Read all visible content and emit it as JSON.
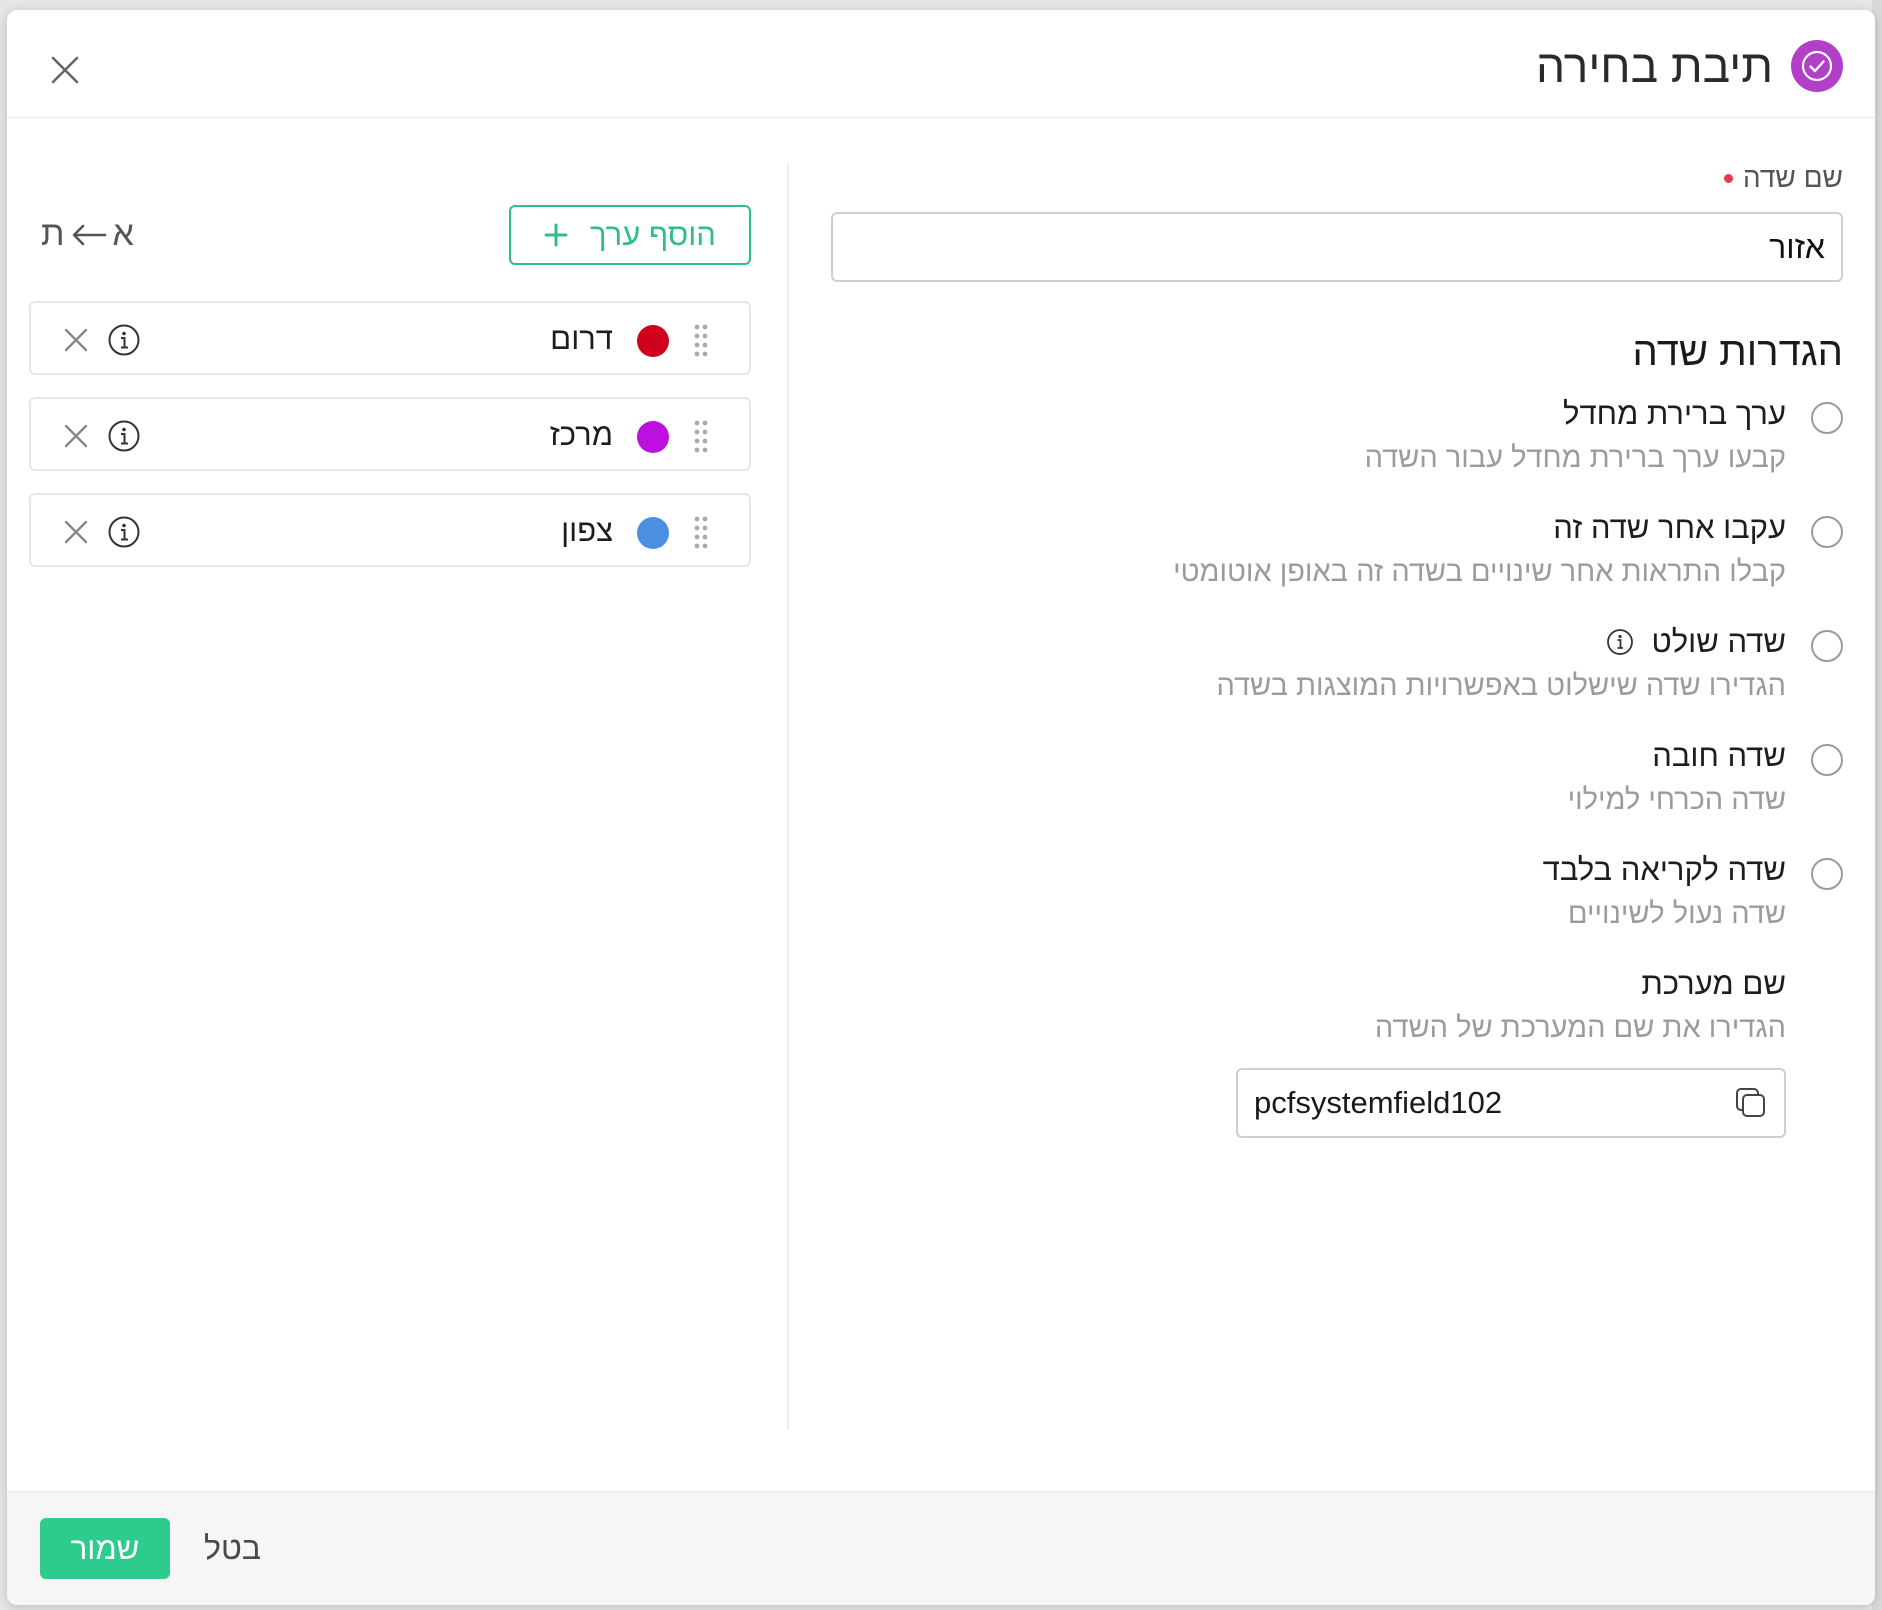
{
  "dialog": {
    "title": "תיבת בחירה",
    "accent_color": "#b23fc8"
  },
  "field_name": {
    "label": "שם שדה",
    "value": "אזור",
    "required_color": "#e8394d"
  },
  "settings": {
    "title": "הגדרות שדה",
    "options": [
      {
        "title": "ערך ברירת מחדל",
        "description": "קבעו ערך ברירת מחדל עבור השדה"
      },
      {
        "title": "עקבו אחר שדה זה",
        "description": "קבלו התראות אחר שינויים בשדה זה באופן אוטומטי"
      },
      {
        "title": "שדה שולט",
        "description": "הגדירו שדה שישלוט באפשרויות המוצגות בשדה",
        "info_icon": "info-icon"
      },
      {
        "title": "שדה חובה",
        "description": "שדה הכרחי למילוי"
      },
      {
        "title": "שדה לקריאה בלבד",
        "description": "שדה נעול לשינויים"
      }
    ],
    "system_name": {
      "title": "שם מערכת",
      "description": "הגדירו את שם המערכת של השדה",
      "value": "pcfsystemfield102"
    }
  },
  "values_panel": {
    "add_button_label": "הוסף ערך",
    "add_button_color": "#2cbf8a",
    "sort_from": "א",
    "sort_to": "ת",
    "items": [
      {
        "label": "דרום",
        "color": "#d0021b"
      },
      {
        "label": "מרכז",
        "color": "#bd10e0"
      },
      {
        "label": "צפון",
        "color": "#4a90e2"
      }
    ]
  },
  "footer": {
    "save_label": "שמור",
    "cancel_label": "בטל",
    "save_color": "#2ecb8f"
  }
}
